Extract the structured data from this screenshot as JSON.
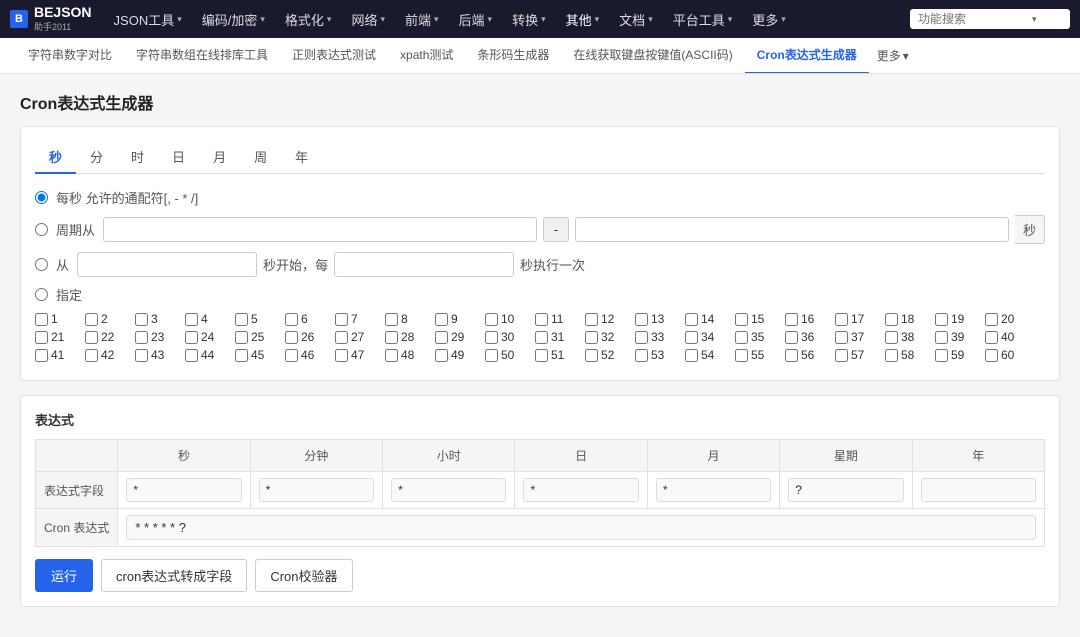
{
  "logo": {
    "icon": "B",
    "title": "BEJSON",
    "subtitle": "助手2011"
  },
  "topnav": {
    "items": [
      {
        "label": "JSON工具",
        "has_arrow": true
      },
      {
        "label": "编码/加密",
        "has_arrow": true
      },
      {
        "label": "格式化",
        "has_arrow": true
      },
      {
        "label": "网络",
        "has_arrow": true
      },
      {
        "label": "前端",
        "has_arrow": true
      },
      {
        "label": "后端",
        "has_arrow": true
      },
      {
        "label": "转换",
        "has_arrow": true
      },
      {
        "label": "其他",
        "has_arrow": true,
        "active": true
      },
      {
        "label": "文档",
        "has_arrow": true
      },
      {
        "label": "平台工具",
        "has_arrow": true
      },
      {
        "label": "更多",
        "has_arrow": true
      }
    ],
    "search_placeholder": "功能搜索"
  },
  "secnav": {
    "items": [
      {
        "label": "字符串数字对比"
      },
      {
        "label": "字符串数组在线排库工具"
      },
      {
        "label": "正则表达式测试"
      },
      {
        "label": "xpath测试"
      },
      {
        "label": "条形码生成器"
      },
      {
        "label": "在线获取键盘按键值(ASCII码)"
      },
      {
        "label": "Cron表达式生成器",
        "active": true
      },
      {
        "label": "更多",
        "is_more": true
      }
    ]
  },
  "page": {
    "title": "Cron表达式生成器"
  },
  "cron_tabs": {
    "tabs": [
      {
        "label": "秒",
        "active": true
      },
      {
        "label": "分"
      },
      {
        "label": "时"
      },
      {
        "label": "日"
      },
      {
        "label": "月"
      },
      {
        "label": "周"
      },
      {
        "label": "年"
      }
    ]
  },
  "second_section": {
    "radio1_label": "每秒 允许的通配符[, - * /]",
    "radio2_label": "周期从",
    "dash_label": "-",
    "unit_label": "秒",
    "radio3_from": "从",
    "radio3_mid": "秒开始，每",
    "radio3_end": "秒执行一次",
    "radio4_label": "指定",
    "checkboxes_row1": [
      1,
      2,
      3,
      4,
      5,
      6,
      7,
      8,
      9,
      10,
      11,
      12,
      13,
      14,
      15,
      16,
      17,
      18,
      19,
      20
    ],
    "checkboxes_row2": [
      21,
      22,
      23,
      24,
      25,
      26,
      27,
      28,
      29,
      30,
      31,
      32,
      33,
      34,
      35,
      36,
      37,
      38,
      39,
      40
    ],
    "checkboxes_row3": [
      41,
      42,
      43,
      44,
      45,
      46,
      47,
      48,
      49,
      50,
      51,
      52,
      53,
      54,
      55,
      56,
      57,
      58,
      59,
      60
    ]
  },
  "expression_section": {
    "title": "表达式",
    "headers": [
      "秒",
      "分钟",
      "小时",
      "日",
      "月",
      "星期",
      "年"
    ],
    "field_row_label": "表达式字段",
    "field_values": [
      "*",
      "*",
      "*",
      "*",
      "*",
      "?",
      ""
    ],
    "cron_row_label": "Cron 表达式",
    "cron_value": "* * * * * ?"
  },
  "buttons": {
    "run": "运行",
    "to_fields": "cron表达式转成字段",
    "validator": "Cron校验器"
  }
}
